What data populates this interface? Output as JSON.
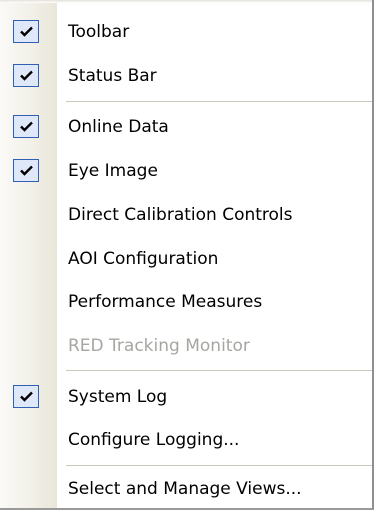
{
  "menu": {
    "items": [
      {
        "label": "Toolbar",
        "checked": true,
        "enabled": true
      },
      {
        "label": "Status Bar",
        "checked": true,
        "enabled": true
      },
      {
        "label": "Online Data",
        "checked": true,
        "enabled": true
      },
      {
        "label": "Eye Image",
        "checked": true,
        "enabled": true
      },
      {
        "label": "Direct Calibration Controls",
        "checked": false,
        "enabled": true
      },
      {
        "label": "AOI Configuration",
        "checked": false,
        "enabled": true
      },
      {
        "label": "Performance Measures",
        "checked": false,
        "enabled": true
      },
      {
        "label": "RED Tracking Monitor",
        "checked": false,
        "enabled": false
      },
      {
        "label": "System Log",
        "checked": true,
        "enabled": true
      },
      {
        "label": "Configure Logging...",
        "checked": false,
        "enabled": true
      },
      {
        "label": "Select and Manage Views...",
        "checked": false,
        "enabled": true
      }
    ]
  },
  "colors": {
    "check_bg": "#dfe8f8",
    "check_border": "#315fb3",
    "disabled_text": "#a7a6a1",
    "separator": "#c9c6ba"
  },
  "icons": {
    "check": "checkmark-icon"
  }
}
